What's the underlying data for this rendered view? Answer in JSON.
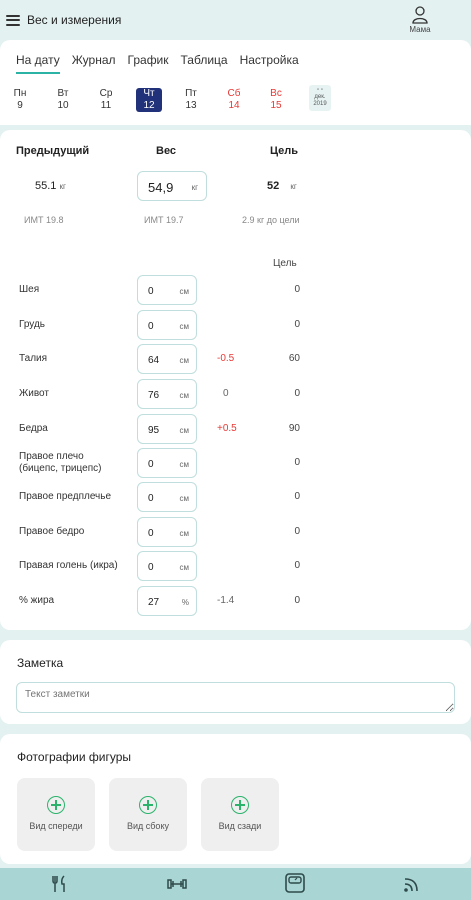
{
  "app": {
    "title": "Вес и измерения",
    "user_name": "Мама"
  },
  "tabs": [
    "На дату",
    "Журнал",
    "График",
    "Таблица",
    "Настройка"
  ],
  "days": [
    {
      "name": "Пн",
      "num": "9"
    },
    {
      "name": "Вт",
      "num": "10"
    },
    {
      "name": "Ср",
      "num": "11"
    },
    {
      "name": "Чт",
      "num": "12"
    },
    {
      "name": "Пт",
      "num": "13"
    },
    {
      "name": "Сб",
      "num": "14"
    },
    {
      "name": "Вс",
      "num": "15"
    }
  ],
  "calendar": {
    "month": "дек.",
    "year": "2019"
  },
  "weight": {
    "prev_header": "Предыдущий",
    "weight_header": "Вес",
    "goal_header": "Цель",
    "prev_value": "55.1",
    "current_value": "54,9",
    "goal_value": "52",
    "unit": "кг",
    "prev_bmi": "ИМТ 19.8",
    "current_bmi": "ИМТ 19.7",
    "to_goal": "2.9 кг до цели"
  },
  "measurements": {
    "goal_header": "Цель",
    "rows": [
      {
        "label": "Шея",
        "value": "0",
        "unit": "см",
        "diff": "",
        "goal": "0"
      },
      {
        "label": "Грудь",
        "value": "0",
        "unit": "см",
        "diff": "",
        "goal": "0"
      },
      {
        "label": "Талия",
        "value": "64",
        "unit": "см",
        "diff": "-0.5",
        "goal": "60"
      },
      {
        "label": "Живот",
        "value": "76",
        "unit": "см",
        "diff": "0",
        "goal": "0"
      },
      {
        "label": "Бедра",
        "value": "95",
        "unit": "см",
        "diff": "+0.5",
        "goal": "90"
      },
      {
        "label": "Правое плечо (бицепс, трицепс)",
        "value": "0",
        "unit": "см",
        "diff": "",
        "goal": "0"
      },
      {
        "label": "Правое предплечье",
        "value": "0",
        "unit": "см",
        "diff": "",
        "goal": "0"
      },
      {
        "label": "Правое бедро",
        "value": "0",
        "unit": "см",
        "diff": "",
        "goal": "0"
      },
      {
        "label": "Правая голень (икра)",
        "value": "0",
        "unit": "см",
        "diff": "",
        "goal": "0"
      },
      {
        "label": "% жира",
        "value": "27",
        "unit": "%",
        "diff": "-1.4",
        "goal": "0"
      }
    ]
  },
  "note": {
    "title": "Заметка",
    "placeholder": "Текст заметки"
  },
  "photos": {
    "title": "Фотографии фигуры",
    "buttons": [
      "Вид спереди",
      "Вид сбоку",
      "Вид сзади"
    ]
  },
  "colors": {
    "accent": "#2bb3a6",
    "selected_day": "#22327a",
    "weekend": "#e53935",
    "bottom_bar": "#a9d6d4"
  }
}
